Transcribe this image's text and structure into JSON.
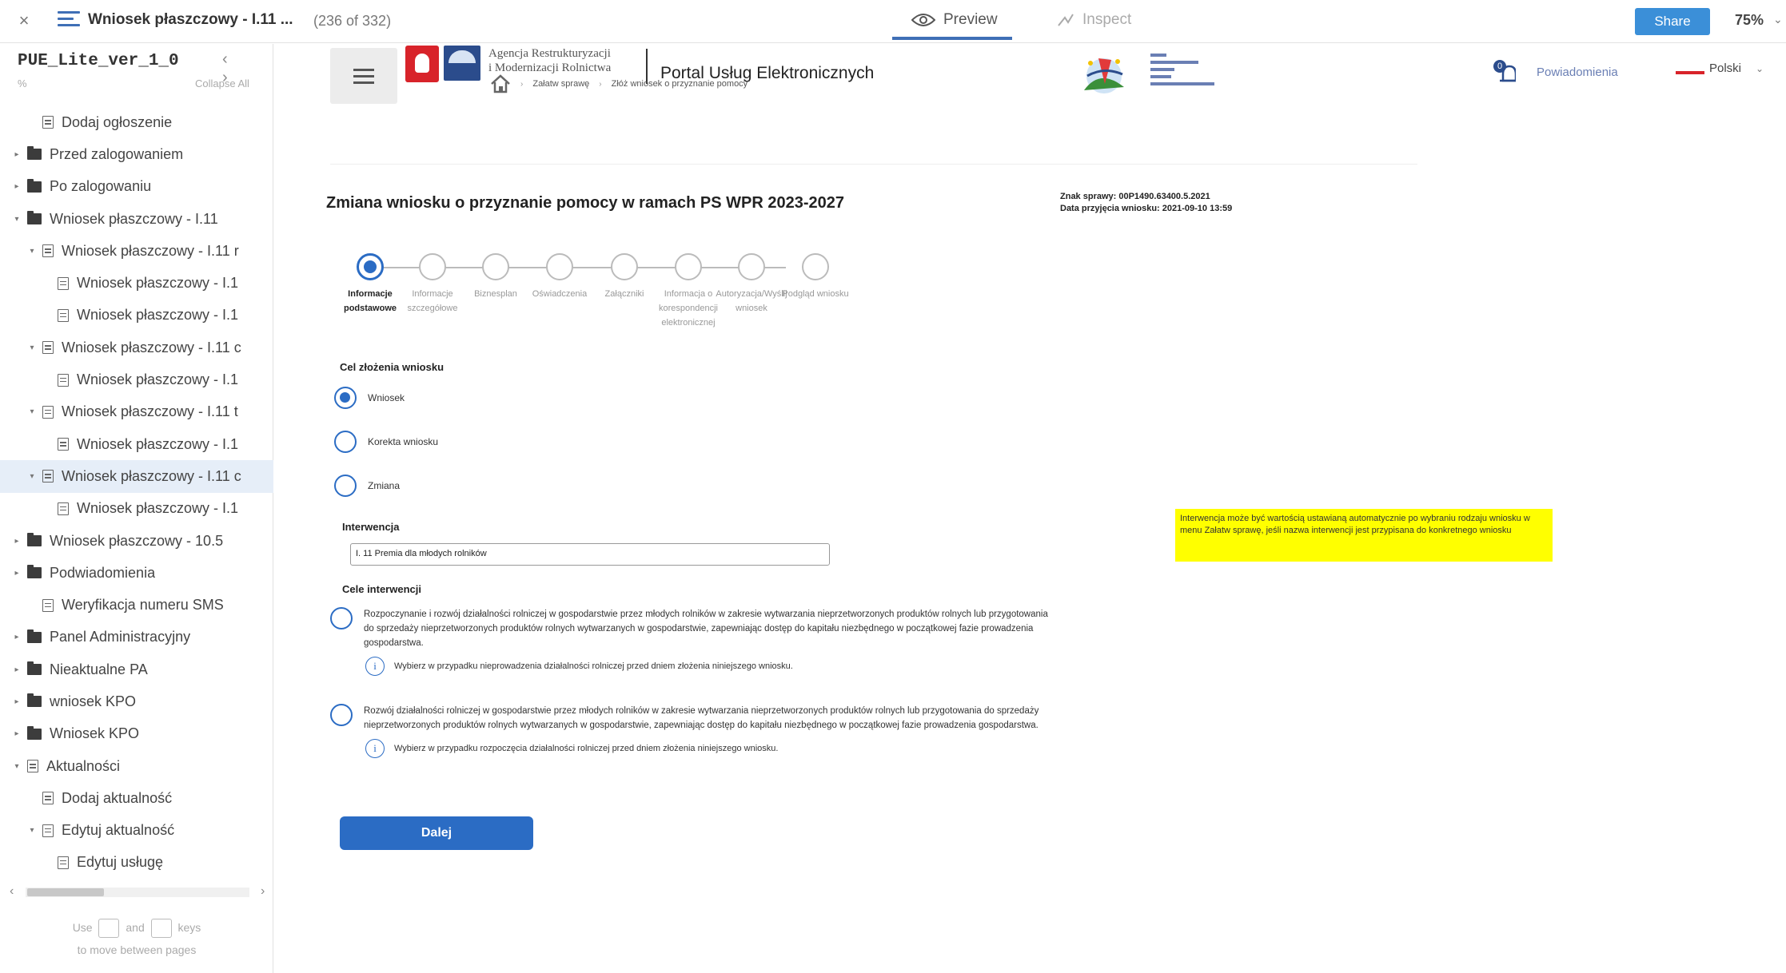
{
  "topbar": {
    "close": "×",
    "title": "Wniosek płaszczowy - I.11 ...",
    "pages": "(236 of 332)",
    "preview": "Preview",
    "inspect": "Inspect",
    "share": "Share",
    "zoom": "75%"
  },
  "sidebar": {
    "project": "PUE_Lite_ver_1_0",
    "nav": "‹ ›",
    "sub": "%",
    "collapse": "Collapse All",
    "items": [
      {
        "label": "Dodaj ogłoszenie",
        "indent": 1,
        "icon": "page",
        "caret": ""
      },
      {
        "label": "Przed zalogowaniem",
        "indent": 0,
        "icon": "folder",
        "caret": "▸"
      },
      {
        "label": "Po zalogowaniu",
        "indent": 0,
        "icon": "folder",
        "caret": "▸"
      },
      {
        "label": "Wniosek płaszczowy - I.11",
        "indent": 0,
        "icon": "folder",
        "caret": "▾"
      },
      {
        "label": "Wniosek płaszczowy - I.11 r",
        "indent": 1,
        "icon": "page",
        "caret": "▾"
      },
      {
        "label": "Wniosek płaszczowy - I.1",
        "indent": 2,
        "icon": "page",
        "caret": ""
      },
      {
        "label": "Wniosek płaszczowy - I.1",
        "indent": 2,
        "icon": "page",
        "caret": ""
      },
      {
        "label": "Wniosek płaszczowy - I.11 c",
        "indent": 1,
        "icon": "page",
        "caret": "▾"
      },
      {
        "label": "Wniosek płaszczowy - I.1",
        "indent": 2,
        "icon": "page",
        "caret": ""
      },
      {
        "label": "Wniosek płaszczowy - I.11 t",
        "indent": 1,
        "icon": "page",
        "caret": "▾"
      },
      {
        "label": "Wniosek płaszczowy - I.1",
        "indent": 2,
        "icon": "page",
        "caret": ""
      },
      {
        "label": "Wniosek płaszczowy - I.11 c",
        "indent": 1,
        "icon": "page",
        "caret": "▾",
        "selected": true
      },
      {
        "label": "Wniosek płaszczowy - I.1",
        "indent": 2,
        "icon": "page",
        "caret": ""
      },
      {
        "label": "Wniosek płaszczowy - 10.5",
        "indent": 0,
        "icon": "folder",
        "caret": "▸"
      },
      {
        "label": "Podwiadomienia",
        "indent": 0,
        "icon": "folder",
        "caret": "▸"
      },
      {
        "label": "Weryfikacja numeru SMS",
        "indent": 1,
        "icon": "page",
        "caret": ""
      },
      {
        "label": "Panel Administracyjny",
        "indent": 0,
        "icon": "folder",
        "caret": "▸"
      },
      {
        "label": "Nieaktualne PA",
        "indent": 0,
        "icon": "folder",
        "caret": "▸"
      },
      {
        "label": "wniosek KPO",
        "indent": 0,
        "icon": "folder",
        "caret": "▸"
      },
      {
        "label": "Wniosek KPO",
        "indent": 0,
        "icon": "folder",
        "caret": "▸"
      },
      {
        "label": "Aktualności",
        "indent": 0,
        "icon": "page",
        "caret": "▾"
      },
      {
        "label": "Dodaj aktualność",
        "indent": 1,
        "icon": "page",
        "caret": ""
      },
      {
        "label": "Edytuj aktualność",
        "indent": 1,
        "icon": "page",
        "caret": "▾"
      },
      {
        "label": "Edytuj usługę",
        "indent": 2,
        "icon": "page",
        "caret": ""
      }
    ],
    "hint_use": "Use",
    "hint_and": "and",
    "hint_keys": "keys",
    "hint_line2": "to move between pages"
  },
  "header": {
    "agency_line1": "Agencja Restrukturyzacji",
    "agency_line2": "i Modernizacji Rolnictwa",
    "portal_title": "Portal Usług Elektronicznych",
    "notif_count": "0",
    "notifications": "Powiadomienia",
    "language": "Polski"
  },
  "breadcrumb": {
    "item1": "Załatw sprawę",
    "item2": "Złóż wniosek o przyznanie pomocy"
  },
  "form": {
    "title": "Zmiana wniosku o przyznanie pomocy w ramach PS WPR 2023-2027",
    "case_number": "Znak sprawy: 00P1490.63400.5.2021",
    "accept_date": "Data przyjęcia wniosku: 2021-09-10 13:59",
    "steps": [
      {
        "label": "Informacje podstawowe",
        "active": true
      },
      {
        "label": "Informacje szczegółowe",
        "active": false
      },
      {
        "label": "Biznesplan",
        "active": false
      },
      {
        "label": "Oświadczenia",
        "active": false
      },
      {
        "label": "Załączniki",
        "active": false
      },
      {
        "label": "Informacja o korespondencji elektronicznej",
        "active": false
      },
      {
        "label": "Autoryzacja/Wyślij wniosek",
        "active": false
      },
      {
        "label": "Podgląd wniosku",
        "active": false
      }
    ],
    "purpose_label": "Cel złożenia wniosku",
    "purpose_options": [
      "Wniosek",
      "Korekta wniosku",
      "Zmiana"
    ],
    "intervention_label": "Interwencja",
    "intervention_value": "I. 11 Premia dla młodych rolników",
    "goals_label": "Cele interwencji",
    "goals": [
      {
        "text": "Rozpoczynanie i rozwój działalności rolniczej w gospodarstwie przez młodych rolników w zakresie wytwarzania nieprzetworzonych produktów rolnych lub przygotowania do sprzedaży nieprzetworzonych produktów rolnych wytwarzanych w gospodarstwie, zapewniając dostęp do kapitału niezbędnego w początkowej fazie prowadzenia gospodarstwa.",
        "info": "Wybierz w przypadku nieprowadzenia działalności rolniczej przed dniem złożenia niniejszego wniosku."
      },
      {
        "text": "Rozwój działalności rolniczej w gospodarstwie przez młodych rolników w zakresie wytwarzania nieprzetworzonych produktów rolnych lub przygotowania do sprzedaży nieprzetworzonych produktów rolnych wytwarzanych w gospodarstwie, zapewniając dostęp do kapitału niezbędnego w początkowej fazie prowadzenia gospodarstwa.",
        "info": "Wybierz w przypadku rozpoczęcia działalności rolniczej przed dniem złożenia niniejszego wniosku."
      }
    ],
    "info_icon": "i",
    "next_button": "Dalej"
  },
  "note": {
    "text": "Interwencja może być wartością ustawianą automatycznie po wybraniu rodzaju wniosku w menu Załatw sprawę, jeśli nazwa interwencji jest przypisana do konkretnego wniosku"
  }
}
